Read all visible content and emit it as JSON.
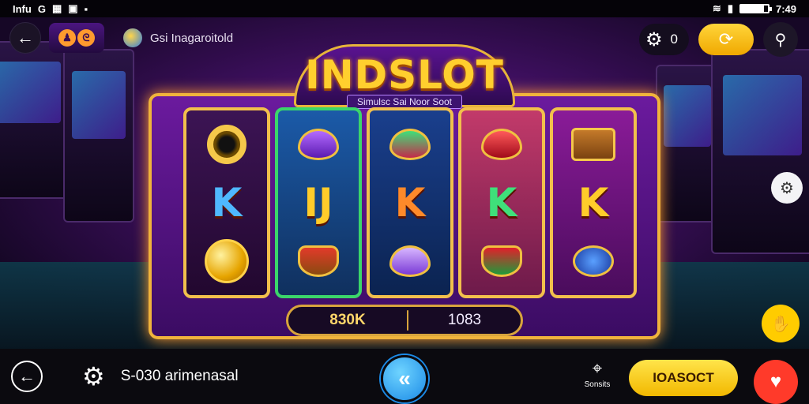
{
  "status_bar": {
    "left_text": "Infu",
    "left_icons": [
      "g-icon",
      "calendar-icon",
      "image-icon",
      "square-icon"
    ],
    "time": "7:49",
    "battery_level": 0.85
  },
  "top_bar": {
    "title": "Gsi Inagaroitold",
    "gear_count": "0"
  },
  "game": {
    "name": "INDSLOT",
    "tagline": "Simulsc Sai Noor Soot",
    "reels": [
      [
        "ring",
        "K",
        "coin"
      ],
      [
        "purple-gem",
        "IJ",
        "red-bowl"
      ],
      [
        "green-gem",
        "K",
        "purple-crystal"
      ],
      [
        "red-gem",
        "K",
        "green-bowl"
      ],
      [
        "chest",
        "K",
        "blue-pouch"
      ]
    ]
  },
  "balance": {
    "win": "830K",
    "bet": "1083"
  },
  "bottom_bar": {
    "label": "S-030 arimenasal",
    "map_label": "Sonsits",
    "primary_button": "IOASOCT"
  },
  "colors": {
    "accent_gold": "#f0b33c",
    "primary_yellow": "#ffd53a",
    "center_blue": "#1b8ae6",
    "danger_red": "#ff3a2a"
  }
}
